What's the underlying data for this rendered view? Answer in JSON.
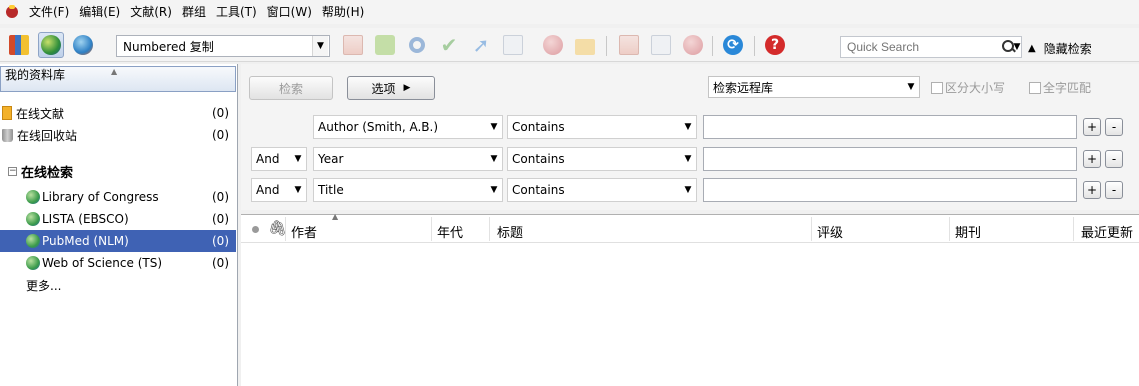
{
  "menu": {
    "items": [
      "文件(F)",
      "编辑(E)",
      "文献(R)",
      "群组",
      "工具(T)",
      "窗口(W)",
      "帮助(H)"
    ]
  },
  "toolbar": {
    "output_style": "Numbered 复制",
    "quick_search_placeholder": "Quick Search",
    "hide_search_label": "隐藏检索",
    "icons": [
      "local-library-icon",
      "online-search-mode-icon",
      "integrated-library-icon",
      "new-reference-icon",
      "insert-citation-icon",
      "find-full-text-icon",
      "approve-icon",
      "export-icon",
      "open-link-icon",
      "online-search-icon",
      "new-group-icon",
      "open-file-icon",
      "preview-icon",
      "link-icon",
      "sync-icon",
      "help-icon"
    ]
  },
  "sidebar": {
    "header": "我的资料库",
    "items": [
      {
        "label": "在线文献",
        "count": "(0)"
      },
      {
        "label": "在线回收站",
        "count": "(0)"
      }
    ],
    "group_label": "在线检索",
    "online": [
      {
        "label": "Library of Congress",
        "count": "(0)"
      },
      {
        "label": "LISTA (EBSCO)",
        "count": "(0)"
      },
      {
        "label": "PubMed (NLM)",
        "count": "(0)"
      },
      {
        "label": "Web of Science (TS)",
        "count": "(0)"
      }
    ],
    "more": "更多..."
  },
  "search": {
    "search_button": "检索",
    "options_button": "选项",
    "remote_library": "检索远程库",
    "match_case": "区分大小写",
    "match_words": "全字匹配",
    "rows": [
      {
        "bool": "",
        "field": "Author (Smith, A.B.)",
        "op": "Contains",
        "value": ""
      },
      {
        "bool": "And",
        "field": "Year",
        "op": "Contains",
        "value": ""
      },
      {
        "bool": "And",
        "field": "Title",
        "op": "Contains",
        "value": ""
      }
    ],
    "plus": "+",
    "minus": "-"
  },
  "reference_list": {
    "columns": [
      "作者",
      "年代",
      "标题",
      "评级",
      "期刊",
      "最近更新"
    ]
  }
}
